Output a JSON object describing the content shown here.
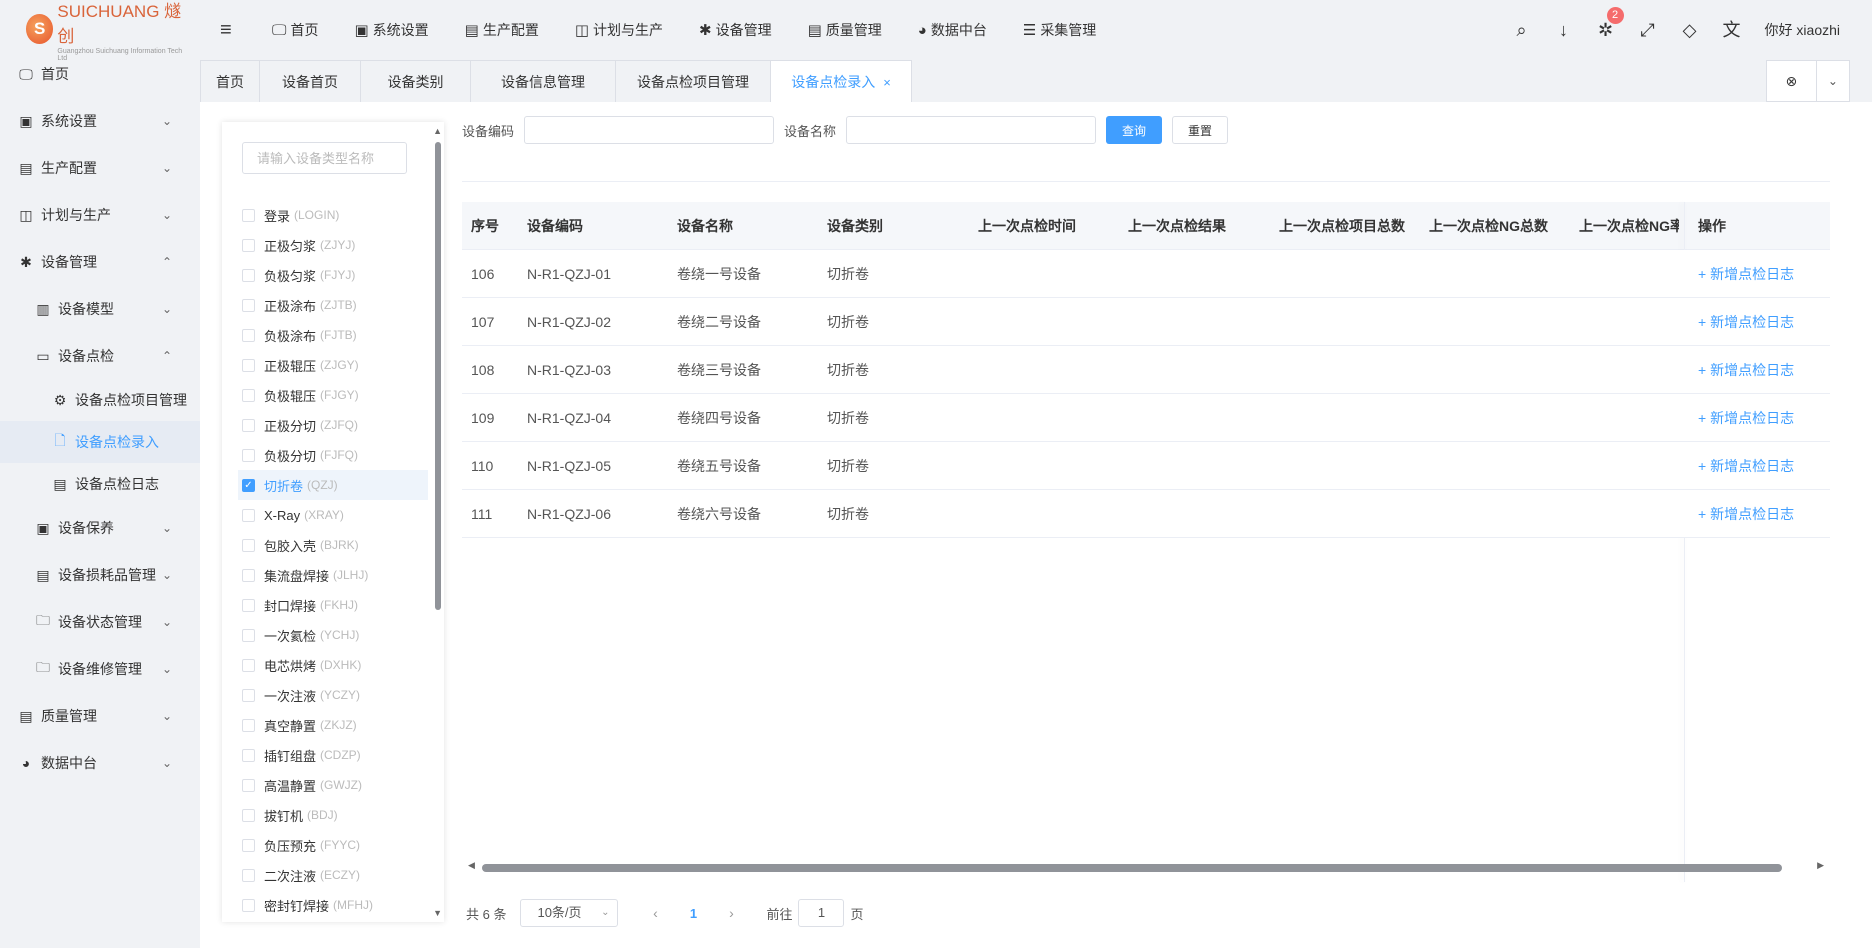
{
  "header": {
    "logo_mark": "S",
    "logo_main": "SUICHUANG 燧创",
    "logo_sub": "Guangzhou Suichuang Information Tech Ltd",
    "nav": [
      {
        "label": "首页",
        "icon": "monitor-icon",
        "glyph": "🖵"
      },
      {
        "label": "系统设置",
        "icon": "user-badge-icon",
        "glyph": "▣"
      },
      {
        "label": "生产配置",
        "icon": "briefcase-icon",
        "glyph": "▤"
      },
      {
        "label": "计划与生产",
        "icon": "windows-icon",
        "glyph": "◫"
      },
      {
        "label": "设备管理",
        "icon": "asterisk-icon",
        "glyph": "✱"
      },
      {
        "label": "质量管理",
        "icon": "briefcase-icon",
        "glyph": "▤"
      },
      {
        "label": "数据中台",
        "icon": "pie-chart-icon",
        "glyph": "◕"
      },
      {
        "label": "采集管理",
        "icon": "database-icon",
        "glyph": "☰"
      }
    ],
    "notification_count": "2",
    "greeting": "你好 xiaozhi"
  },
  "sidebar": {
    "items": [
      {
        "label": "首页",
        "glyph": "🖵",
        "icon": "monitor-icon",
        "arrow": ""
      },
      {
        "label": "系统设置",
        "glyph": "▣",
        "icon": "user-badge-icon",
        "arrow": "⌄"
      },
      {
        "label": "生产配置",
        "glyph": "▤",
        "icon": "briefcase-icon",
        "arrow": "⌄"
      },
      {
        "label": "计划与生产",
        "glyph": "◫",
        "icon": "windows-icon",
        "arrow": "⌄"
      },
      {
        "label": "设备管理",
        "glyph": "✱",
        "icon": "asterisk-icon",
        "arrow": "⌃"
      },
      {
        "label": "设备模型",
        "glyph": "▥",
        "icon": "columns-icon",
        "arrow": "⌄"
      },
      {
        "label": "设备点检",
        "glyph": "▭",
        "icon": "server-icon",
        "arrow": "⌃"
      },
      {
        "label": "设备点检项目管理",
        "glyph": "⚙",
        "icon": "gear-icon",
        "arrow": ""
      },
      {
        "label": "设备点检录入",
        "glyph": "🗋",
        "icon": "file-icon",
        "arrow": ""
      },
      {
        "label": "设备点检日志",
        "glyph": "▤",
        "icon": "list-icon",
        "arrow": ""
      },
      {
        "label": "设备保养",
        "glyph": "▣",
        "icon": "maintenance-icon",
        "arrow": "⌄"
      },
      {
        "label": "设备损耗品管理",
        "glyph": "▤",
        "icon": "list-icon",
        "arrow": "⌄"
      },
      {
        "label": "设备状态管理",
        "glyph": "🗀",
        "icon": "folder-icon",
        "arrow": "⌄"
      },
      {
        "label": "设备维修管理",
        "glyph": "🗀",
        "icon": "folder-icon",
        "arrow": "⌄"
      },
      {
        "label": "质量管理",
        "glyph": "▤",
        "icon": "briefcase-icon",
        "arrow": "⌄"
      },
      {
        "label": "数据中台",
        "glyph": "◕",
        "icon": "pie-chart-icon",
        "arrow": "⌄"
      }
    ]
  },
  "tabs": [
    {
      "label": "首页"
    },
    {
      "label": "设备首页"
    },
    {
      "label": "设备类别"
    },
    {
      "label": "设备信息管理"
    },
    {
      "label": "设备点检项目管理"
    },
    {
      "label": "设备点检录入",
      "close": "×"
    }
  ],
  "tree": {
    "placeholder": "请输入设备类型名称",
    "items": [
      {
        "name": "登录",
        "code": "(LOGIN)"
      },
      {
        "name": "正极匀浆",
        "code": "(ZJYJ)"
      },
      {
        "name": "负极匀浆",
        "code": "(FJYJ)"
      },
      {
        "name": "正极涂布",
        "code": "(ZJTB)"
      },
      {
        "name": "负极涂布",
        "code": "(FJTB)"
      },
      {
        "name": "正极辊压",
        "code": "(ZJGY)"
      },
      {
        "name": "负极辊压",
        "code": "(FJGY)"
      },
      {
        "name": "正极分切",
        "code": "(ZJFQ)"
      },
      {
        "name": "负极分切",
        "code": "(FJFQ)"
      },
      {
        "name": "切折卷",
        "code": "(QZJ)",
        "checked": true
      },
      {
        "name": "X-Ray",
        "code": "(XRAY)"
      },
      {
        "name": "包胶入壳",
        "code": "(BJRK)"
      },
      {
        "name": "集流盘焊接",
        "code": "(JLHJ)"
      },
      {
        "name": "封口焊接",
        "code": "(FKHJ)"
      },
      {
        "name": "一次氦检",
        "code": "(YCHJ)"
      },
      {
        "name": "电芯烘烤",
        "code": "(DXHK)"
      },
      {
        "name": "一次注液",
        "code": "(YCZY)"
      },
      {
        "name": "真空静置",
        "code": "(ZKJZ)"
      },
      {
        "name": "插钉组盘",
        "code": "(CDZP)"
      },
      {
        "name": "高温静置",
        "code": "(GWJZ)"
      },
      {
        "name": "拔钉机",
        "code": "(BDJ)"
      },
      {
        "name": "负压预充",
        "code": "(FYYC)"
      },
      {
        "name": "二次注液",
        "code": "(ECZY)"
      },
      {
        "name": "密封钉焊接",
        "code": "(MFHJ)"
      }
    ]
  },
  "filter": {
    "code_label": "设备编码",
    "name_label": "设备名称",
    "query_button": "查询",
    "reset_button": "重置"
  },
  "table": {
    "columns": [
      "序号",
      "设备编码",
      "设备名称",
      "设备类别",
      "上一次点检时间",
      "上一次点检结果",
      "上一次点检项目总数",
      "上一次点检NG总数",
      "上一次点检NG率",
      "操作"
    ],
    "rows": [
      {
        "no": "106",
        "code": "N-R1-QZJ-01",
        "name": "卷绕一号设备",
        "type": "切折卷",
        "last_time": "",
        "last_result": "",
        "last_total": "",
        "last_ng": "",
        "last_ng_rate": "",
        "action": "+ 新增点检日志"
      },
      {
        "no": "107",
        "code": "N-R1-QZJ-02",
        "name": "卷绕二号设备",
        "type": "切折卷",
        "last_time": "",
        "last_result": "",
        "last_total": "",
        "last_ng": "",
        "last_ng_rate": "",
        "action": "+ 新增点检日志"
      },
      {
        "no": "108",
        "code": "N-R1-QZJ-03",
        "name": "卷绕三号设备",
        "type": "切折卷",
        "last_time": "",
        "last_result": "",
        "last_total": "",
        "last_ng": "",
        "last_ng_rate": "",
        "action": "+ 新增点检日志"
      },
      {
        "no": "109",
        "code": "N-R1-QZJ-04",
        "name": "卷绕四号设备",
        "type": "切折卷",
        "last_time": "",
        "last_result": "",
        "last_total": "",
        "last_ng": "",
        "last_ng_rate": "",
        "action": "+ 新增点检日志"
      },
      {
        "no": "110",
        "code": "N-R1-QZJ-05",
        "name": "卷绕五号设备",
        "type": "切折卷",
        "last_time": "",
        "last_result": "",
        "last_total": "",
        "last_ng": "",
        "last_ng_rate": "",
        "action": "+ 新增点检日志"
      },
      {
        "no": "111",
        "code": "N-R1-QZJ-06",
        "name": "卷绕六号设备",
        "type": "切折卷",
        "last_time": "",
        "last_result": "",
        "last_total": "",
        "last_ng": "",
        "last_ng_rate": "",
        "action": "+ 新增点检日志"
      }
    ]
  },
  "pager": {
    "total": "共 6 条",
    "page_size": "10条/页",
    "current_page": "1",
    "goto_label": "前往",
    "goto_value": "1",
    "page_unit": "页"
  },
  "colors": {
    "accent": "#409eff",
    "badge": "#f56c6c",
    "brand": "#e8542c"
  }
}
